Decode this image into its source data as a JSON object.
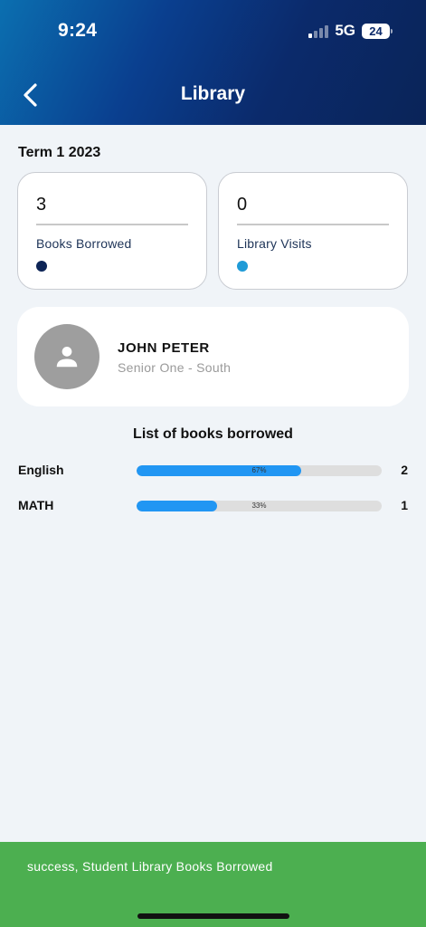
{
  "status_bar": {
    "time": "9:24",
    "network": "5G",
    "battery": "24"
  },
  "header": {
    "title": "Library",
    "back_icon": "chevron-left-icon"
  },
  "term": "Term 1 2023",
  "stats": [
    {
      "value": "3",
      "label": "Books Borrowed",
      "dot_color": "#0d2456"
    },
    {
      "value": "0",
      "label": "Library Visits",
      "dot_color": "#1f9bd7"
    }
  ],
  "student": {
    "name": "JOHN PETER",
    "class": "Senior One - South",
    "avatar_icon": "person-icon"
  },
  "books_section": {
    "title": "List of books borrowed",
    "items": [
      {
        "subject": "English",
        "percent": 0.67,
        "percent_label": "67%",
        "count": "2"
      },
      {
        "subject": "MATH",
        "percent": 0.33,
        "percent_label": "33%",
        "count": "1"
      }
    ]
  },
  "toast": {
    "message": "success, Student Library Books Borrowed",
    "color": "#4caf50"
  },
  "colors": {
    "accent": "#2196f3",
    "header_start": "#0b6fb0",
    "header_end": "#0a2458"
  }
}
